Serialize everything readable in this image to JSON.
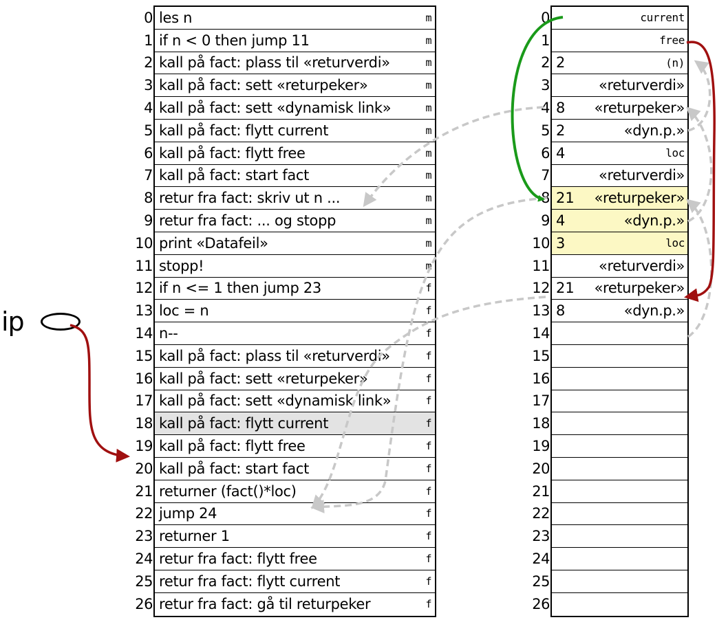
{
  "code": {
    "rows": [
      {
        "idx": "0",
        "text": "les n",
        "tag": "m"
      },
      {
        "idx": "1",
        "text": "if n < 0 then jump 11",
        "tag": "m"
      },
      {
        "idx": "2",
        "text": "kall på fact: plass til «returverdi»",
        "tag": "m"
      },
      {
        "idx": "3",
        "text": "kall på fact: sett «returpeker»",
        "tag": "m"
      },
      {
        "idx": "4",
        "text": "kall på fact: sett «dynamisk link»",
        "tag": "m"
      },
      {
        "idx": "5",
        "text": "kall på fact: flytt current",
        "tag": "m"
      },
      {
        "idx": "6",
        "text": "kall på fact: flytt free",
        "tag": "m"
      },
      {
        "idx": "7",
        "text": "kall på fact: start fact",
        "tag": "m"
      },
      {
        "idx": "8",
        "text": "retur fra fact: skriv ut n ...",
        "tag": "m"
      },
      {
        "idx": "9",
        "text": "retur fra fact: ... og stopp",
        "tag": "m"
      },
      {
        "idx": "10",
        "text": "print «Datafeil»",
        "tag": "m"
      },
      {
        "idx": "11",
        "text": "stopp!",
        "tag": "m"
      },
      {
        "idx": "12",
        "text": "if n <= 1 then jump 23",
        "tag": "f"
      },
      {
        "idx": "13",
        "text": "loc = n",
        "tag": "f"
      },
      {
        "idx": "14",
        "text": "n--",
        "tag": "f"
      },
      {
        "idx": "15",
        "text": "kall på fact: plass til «returverdi»",
        "tag": "f"
      },
      {
        "idx": "16",
        "text": "kall på fact: sett «returpeker»",
        "tag": "f"
      },
      {
        "idx": "17",
        "text": "kall på fact: sett «dynamisk link»",
        "tag": "f"
      },
      {
        "idx": "18",
        "text": "kall på fact: flytt current",
        "tag": "f"
      },
      {
        "idx": "19",
        "text": "kall på fact: flytt free",
        "tag": "f"
      },
      {
        "idx": "20",
        "text": "kall på fact: start fact",
        "tag": "f"
      },
      {
        "idx": "21",
        "text": "returner (fact()*loc)",
        "tag": "f"
      },
      {
        "idx": "22",
        "text": "jump 24",
        "tag": "f"
      },
      {
        "idx": "23",
        "text": "returner 1",
        "tag": "f"
      },
      {
        "idx": "24",
        "text": "retur fra fact: flytt free",
        "tag": "f"
      },
      {
        "idx": "25",
        "text": "retur fra fact: flytt current",
        "tag": "f"
      },
      {
        "idx": "26",
        "text": "retur fra fact: gå til returpeker",
        "tag": "f"
      }
    ],
    "highlighted_row": 18
  },
  "memory": {
    "rows": [
      {
        "idx": "0",
        "value": "",
        "label": "current",
        "mono": true
      },
      {
        "idx": "1",
        "value": "",
        "label": "free",
        "mono": true
      },
      {
        "idx": "2",
        "value": "2",
        "label": "(n)",
        "mono": true
      },
      {
        "idx": "3",
        "value": "",
        "label": "«returverdi»",
        "mono": false
      },
      {
        "idx": "4",
        "value": "8",
        "label": "«returpeker»",
        "mono": false
      },
      {
        "idx": "5",
        "value": "2",
        "label": "«dyn.p.»",
        "mono": false
      },
      {
        "idx": "6",
        "value": "4",
        "label": "loc",
        "mono": true
      },
      {
        "idx": "7",
        "value": "",
        "label": "«returverdi»",
        "mono": false
      },
      {
        "idx": "8",
        "value": "21",
        "label": "«returpeker»",
        "mono": false
      },
      {
        "idx": "9",
        "value": "4",
        "label": "«dyn.p.»",
        "mono": false
      },
      {
        "idx": "10",
        "value": "3",
        "label": "loc",
        "mono": true
      },
      {
        "idx": "11",
        "value": "",
        "label": "«returverdi»",
        "mono": false
      },
      {
        "idx": "12",
        "value": "21",
        "label": "«returpeker»",
        "mono": false
      },
      {
        "idx": "13",
        "value": "8",
        "label": "«dyn.p.»",
        "mono": false
      },
      {
        "idx": "14",
        "value": "",
        "label": "",
        "mono": false
      },
      {
        "idx": "15",
        "value": "",
        "label": "",
        "mono": false
      },
      {
        "idx": "16",
        "value": "",
        "label": "",
        "mono": false
      },
      {
        "idx": "17",
        "value": "",
        "label": "",
        "mono": false
      },
      {
        "idx": "18",
        "value": "",
        "label": "",
        "mono": false
      },
      {
        "idx": "19",
        "value": "",
        "label": "",
        "mono": false
      },
      {
        "idx": "20",
        "value": "",
        "label": "",
        "mono": false
      },
      {
        "idx": "21",
        "value": "",
        "label": "",
        "mono": false
      },
      {
        "idx": "22",
        "value": "",
        "label": "",
        "mono": false
      },
      {
        "idx": "23",
        "value": "",
        "label": "",
        "mono": false
      },
      {
        "idx": "24",
        "value": "",
        "label": "",
        "mono": false
      },
      {
        "idx": "25",
        "value": "",
        "label": "",
        "mono": false
      },
      {
        "idx": "26",
        "value": "",
        "label": "",
        "mono": false
      }
    ],
    "yellow_rows": [
      8,
      9,
      10
    ]
  },
  "ip": {
    "label": "ip",
    "points_to_row": 19
  },
  "colors": {
    "green_arrow": "#1a9a1a",
    "red_arrow": "#a01010",
    "gray_arrow": "#c8c8c8",
    "highlight": "#e3e3e3",
    "yellow": "#fcf8c4"
  }
}
